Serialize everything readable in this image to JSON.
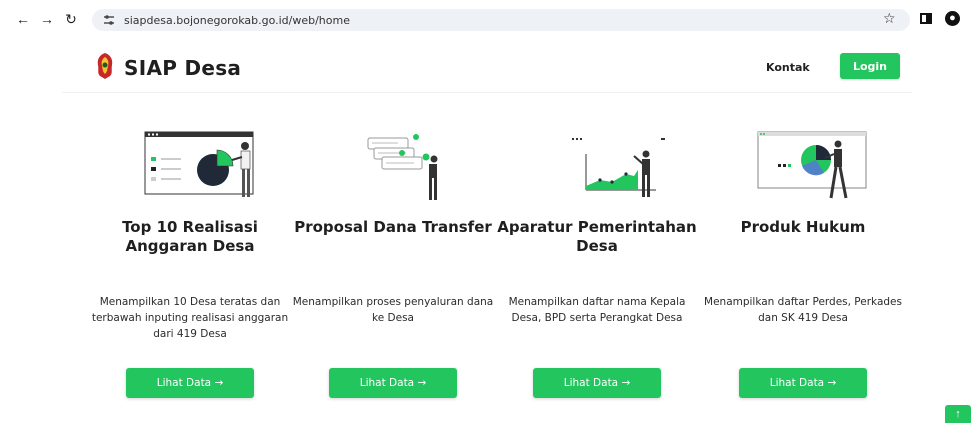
{
  "browser": {
    "url": "siapdesa.bojonegorokab.go.id/web/home"
  },
  "header": {
    "brand": "SIAP Desa",
    "nav_contact": "Kontak",
    "login_label": "Login"
  },
  "cards": [
    {
      "title": "Top 10 Realisasi Anggaran Desa",
      "description": "Menampilkan 10 Desa teratas dan terbawah inputing realisasi anggaran dari 419 Desa",
      "button": "Lihat Data →"
    },
    {
      "title": "Proposal Dana Transfer",
      "description": "Menampilkan proses penyaluran dana ke Desa",
      "button": "Lihat Data →"
    },
    {
      "title": "Aparatur Pemerintahan Desa",
      "description": "Menampilkan daftar nama Kepala Desa, BPD serta Perangkat Desa",
      "button": "Lihat Data →"
    },
    {
      "title": "Produk Hukum",
      "description": "Menampilkan daftar Perdes, Perkades dan SK 419 Desa",
      "button": "Lihat Data →"
    }
  ],
  "scroll_top": "↑",
  "colors": {
    "accent": "#22c55e",
    "dark": "#1f2937"
  },
  "icons": [
    "back-arrow-icon",
    "forward-arrow-icon",
    "reload-icon",
    "site-info-icon",
    "bookmark-star-icon",
    "side-panel-icon",
    "profile-icon"
  ]
}
